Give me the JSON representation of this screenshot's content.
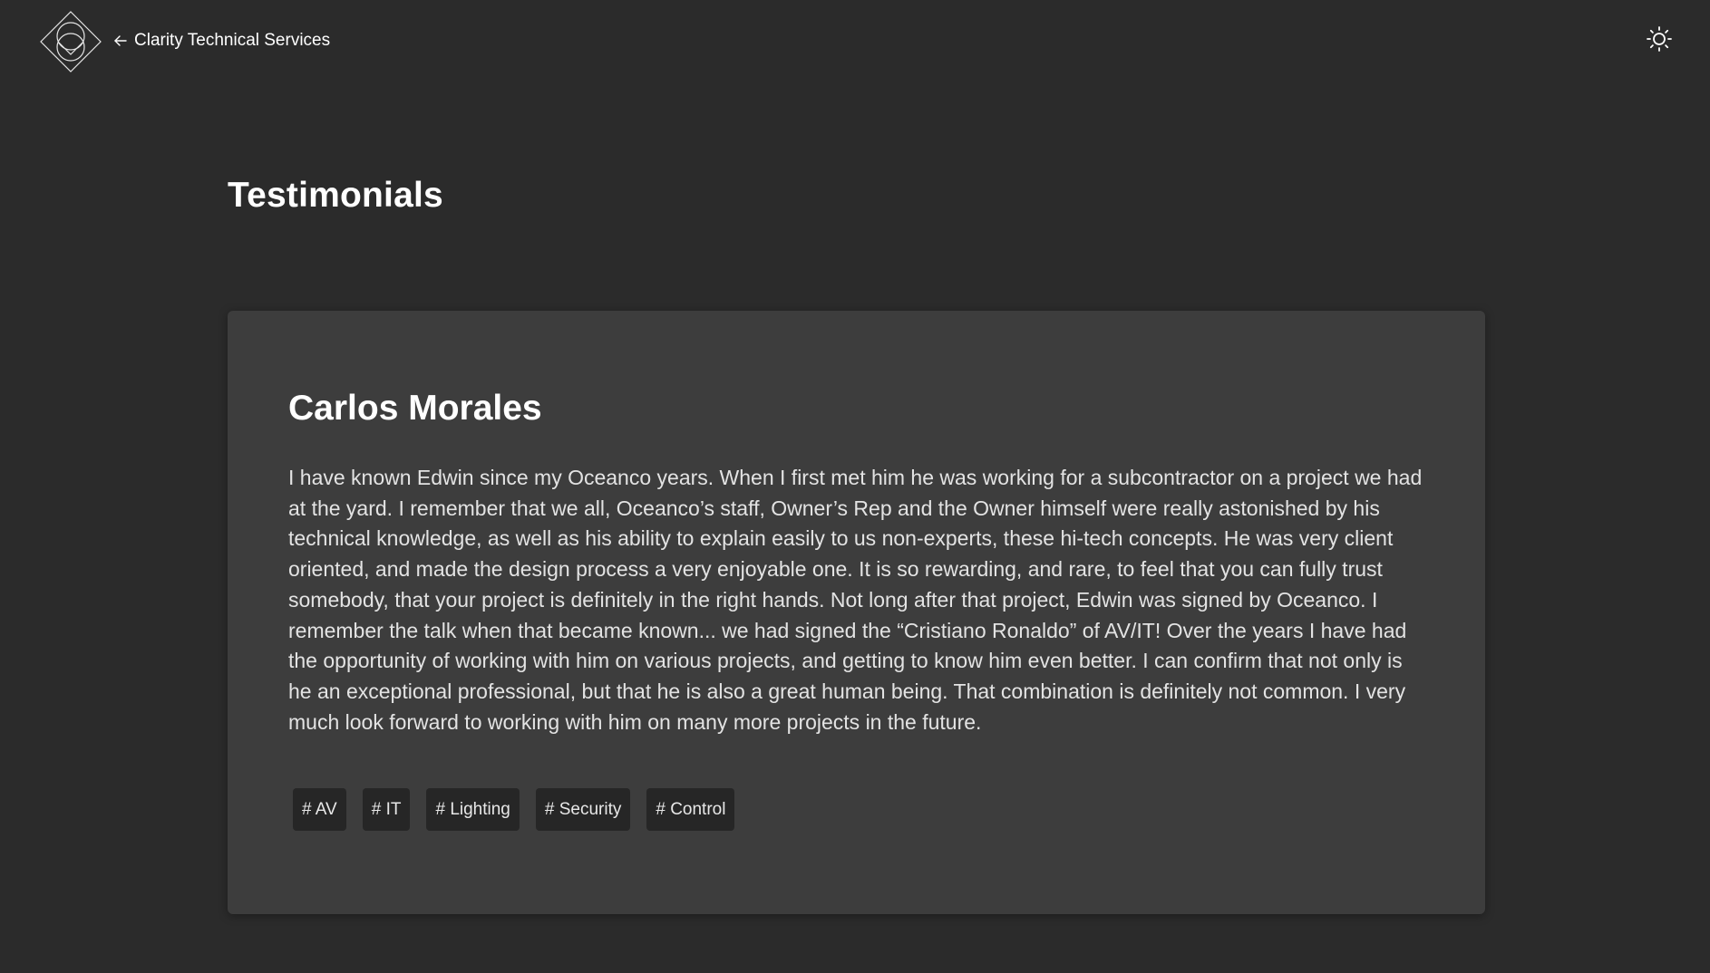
{
  "header": {
    "logo_icon": "diamond-circles-logo-icon",
    "back_icon": "arrow-left-icon",
    "back_label": "Clarity Technical Services",
    "theme_icon": "sun-icon"
  },
  "page": {
    "title": "Testimonials"
  },
  "testimonial": {
    "name": "Carlos Morales",
    "text": "I have known Edwin since my Oceanco years. When I first met him he was working for a subcontractor on a project we had at the yard. I remember that we all, Oceanco’s staff, Owner’s Rep and the Owner himself were really astonished by his technical knowledge, as well as his ability to explain easily to us non-experts, these hi-tech concepts. He was very client oriented, and made the design process a very enjoyable one. It is so rewarding, and rare, to feel that you can fully trust somebody, that your project is definitely in the right hands. Not long after that project, Edwin was signed by Oceanco. I remember the talk when that became known... we had signed the “Cristiano Ronaldo” of AV/IT! Over the years I have had the opportunity of working with him on various projects, and getting to know him even better. I can confirm that not only is he an exceptional professional, but that he is also a great human being. That combination is definitely not common. I very much look forward to working with him on many more projects in the future.",
    "tags": [
      "# AV",
      "# IT",
      "# Lighting",
      "# Security",
      "# Control"
    ]
  },
  "colors": {
    "background": "#2b2b2b",
    "card": "#3d3d3d",
    "tag_background": "#262626",
    "text": "#ffffff",
    "body_text": "#e3e3e3"
  }
}
